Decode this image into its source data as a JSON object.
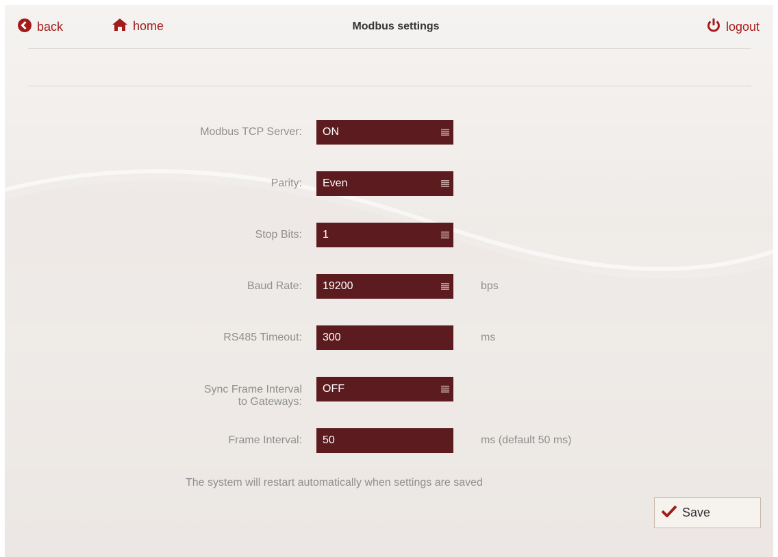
{
  "header": {
    "back_label": "back",
    "home_label": "home",
    "title": "Modbus settings",
    "logout_label": "logout"
  },
  "fields": {
    "modbus_tcp_server": {
      "label": "Modbus TCP Server:",
      "value": "ON"
    },
    "parity": {
      "label": "Parity:",
      "value": "Even"
    },
    "stop_bits": {
      "label": "Stop Bits:",
      "value": "1"
    },
    "baud_rate": {
      "label": "Baud Rate:",
      "value": "19200",
      "unit": "bps"
    },
    "rs485_timeout": {
      "label": "RS485 Timeout:",
      "value": "300",
      "unit": "ms"
    },
    "sync_frame_interval": {
      "label_line1": "Sync Frame Interval",
      "label_line2": "to Gateways:",
      "value": "OFF"
    },
    "frame_interval": {
      "label": "Frame Interval:",
      "value": "50",
      "unit": "ms (default 50 ms)"
    }
  },
  "note": "The system will restart automatically when settings are saved",
  "save_label": "Save",
  "colors": {
    "accent": "#a31c1c",
    "field_bg": "#5c1c1f",
    "label": "#8f8f8f"
  },
  "icons": {
    "back": "back-circle-icon",
    "home": "home-icon",
    "logout": "power-icon",
    "menu": "menu-icon",
    "save": "checkmark-icon"
  }
}
